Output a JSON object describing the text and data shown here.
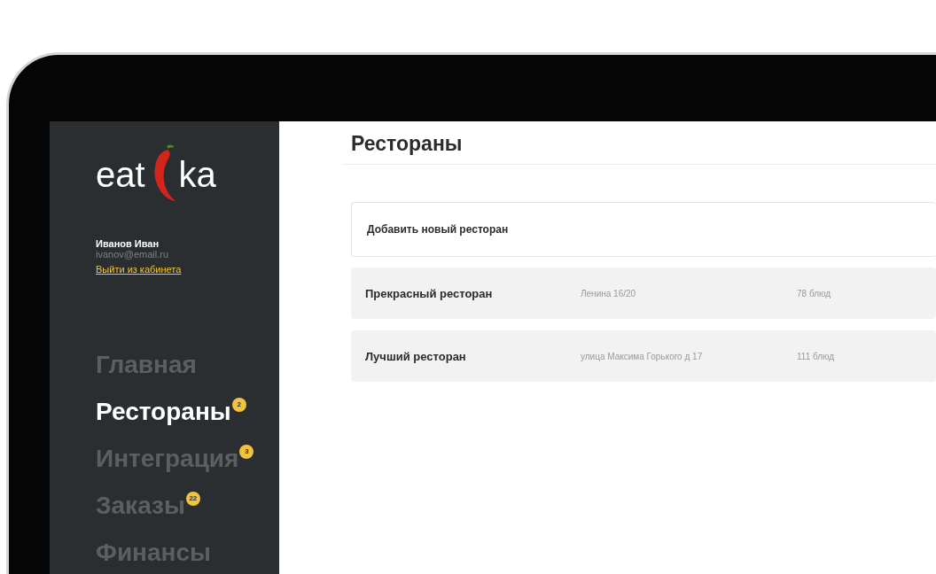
{
  "logo": {
    "text_start": "eat",
    "text_end": "ka"
  },
  "user": {
    "name": "Иванов Иван",
    "email": "ivanov@email.ru",
    "logout": "Выйти из кабинета"
  },
  "nav": [
    {
      "label": "Главная",
      "selected": false
    },
    {
      "label": "Рестораны",
      "selected": true,
      "badge": "2"
    },
    {
      "label": "Интеграция",
      "selected": false,
      "badge": "3"
    },
    {
      "label": "Заказы",
      "selected": false,
      "badge": "22"
    },
    {
      "label": "Финансы",
      "selected": false
    }
  ],
  "page_title": "Рестораны",
  "add_button": "Добавить новый ресторан",
  "restaurants": [
    {
      "name": "Прекрасный ресторан",
      "address": "Ленина 16/20",
      "dishes": "78 блюд"
    },
    {
      "name": "Лучший ресторан",
      "address": "улица Максима Горького д 17",
      "dishes": "111 блюд"
    }
  ]
}
